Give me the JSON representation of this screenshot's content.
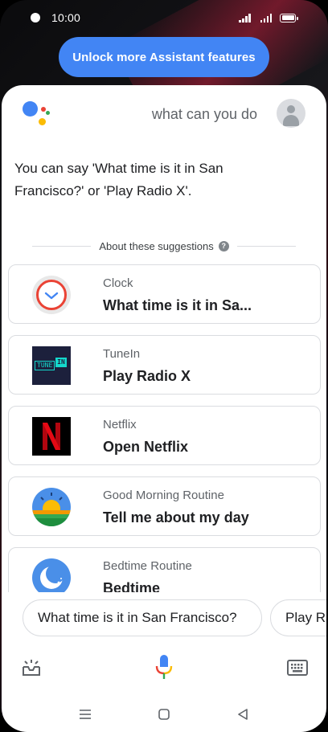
{
  "status_bar": {
    "time": "10:00"
  },
  "unlock_button_label": "Unlock more Assistant features",
  "assistant": {
    "query": "what can you do",
    "response": "You can say 'What time is it in San Francisco?' or 'Play Radio X'.",
    "suggestions_header": "About these suggestions"
  },
  "suggestions": [
    {
      "app": "Clock",
      "command": "What time is it in Sa...",
      "icon": "clock-icon"
    },
    {
      "app": "TuneIn",
      "command": "Play Radio X",
      "icon": "tunein-icon"
    },
    {
      "app": "Netflix",
      "command": "Open Netflix",
      "icon": "netflix-icon"
    },
    {
      "app": "Good Morning Routine",
      "command": "Tell me about my day",
      "icon": "sunrise-icon"
    },
    {
      "app": "Bedtime Routine",
      "command": "Bedtime",
      "icon": "moon-icon"
    }
  ],
  "tunein_logo": {
    "left": "TUNE",
    "right": "IN"
  },
  "chips": [
    "What time is it in San Francisco?",
    "Play Ra"
  ],
  "colors": {
    "accent": "#4285f4",
    "google_blue": "#4285f4",
    "google_red": "#ea4335",
    "google_yellow": "#fbbc05",
    "google_green": "#34a853"
  }
}
